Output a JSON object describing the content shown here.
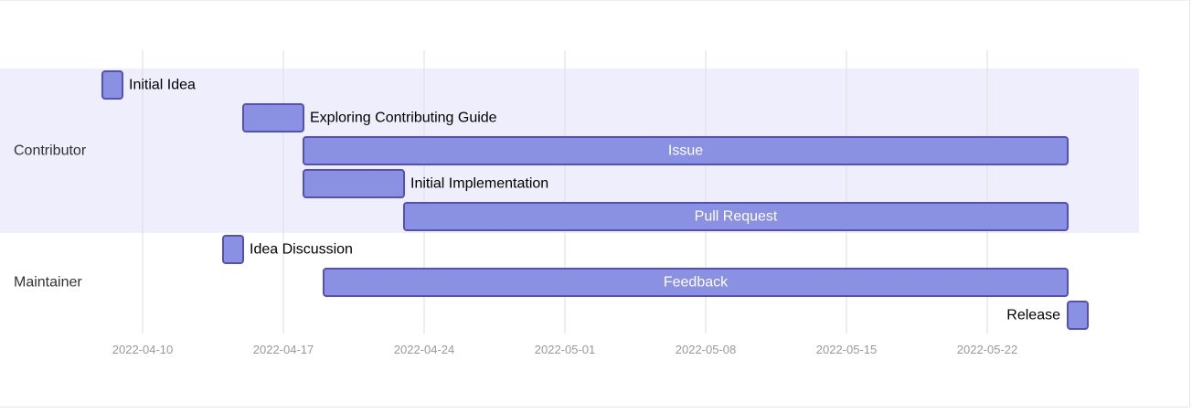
{
  "chart_data": {
    "type": "gantt",
    "title": "",
    "sections": [
      {
        "name": "Contributor",
        "color": "#efeefc",
        "tasks": [
          {
            "name": "Initial Idea",
            "start": "2022-04-08",
            "end": "2022-04-09"
          },
          {
            "name": "Exploring Contributing Guide",
            "start": "2022-04-15",
            "end": "2022-04-18"
          },
          {
            "name": "Issue",
            "start": "2022-04-18",
            "end": "2022-05-26"
          },
          {
            "name": "Initial Implementation",
            "start": "2022-04-18",
            "end": "2022-04-23"
          },
          {
            "name": "Pull Request",
            "start": "2022-04-23",
            "end": "2022-05-26"
          }
        ]
      },
      {
        "name": "Maintainer",
        "color": "#ffffff",
        "tasks": [
          {
            "name": "Idea Discussion",
            "start": "2022-04-14",
            "end": "2022-04-15"
          },
          {
            "name": "Feedback",
            "start": "2022-04-19",
            "end": "2022-05-26"
          },
          {
            "name": "Release",
            "start": "2022-05-26",
            "end": "2022-05-27"
          }
        ]
      }
    ],
    "x_ticks": [
      "2022-04-10",
      "2022-04-17",
      "2022-04-24",
      "2022-05-01",
      "2022-05-08",
      "2022-05-15",
      "2022-05-22"
    ],
    "xlim": [
      "2022-04-08",
      "2022-05-27"
    ],
    "grid": true,
    "colors": {
      "bar_fill": "#8a90e2",
      "bar_stroke": "#534fbc",
      "grid": "#dedede",
      "tick_text": "#999999"
    }
  }
}
